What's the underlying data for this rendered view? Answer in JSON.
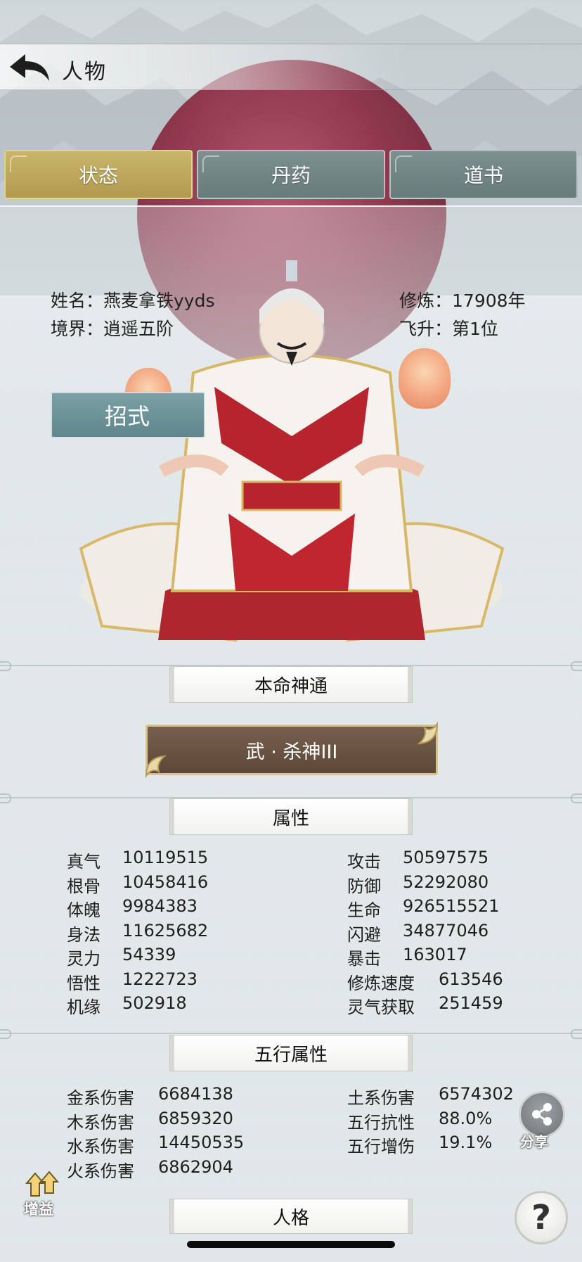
{
  "header": {
    "title": "人物"
  },
  "tabs": [
    {
      "label": "状态",
      "active": true
    },
    {
      "label": "丹药",
      "active": false
    },
    {
      "label": "道书",
      "active": false
    }
  ],
  "profile": {
    "name_label": "姓名：",
    "name": "燕麦拿铁yyds",
    "realm_label": "境界：",
    "realm": "逍遥五阶",
    "cultivation_label": "修炼：",
    "cultivation": "17908年",
    "ascension_label": "飞升：",
    "ascension": "第1位"
  },
  "skill_button": "招式",
  "natal_section": {
    "title": "本命神通",
    "ability": "武 · 杀神III"
  },
  "attributes": {
    "title": "属性",
    "left": [
      {
        "k": "真气",
        "v": "10119515"
      },
      {
        "k": "根骨",
        "v": "10458416"
      },
      {
        "k": "体魄",
        "v": "9984383"
      },
      {
        "k": "身法",
        "v": "11625682"
      },
      {
        "k": "灵力",
        "v": "54339"
      },
      {
        "k": "悟性",
        "v": "1222723"
      },
      {
        "k": "机缘",
        "v": "502918"
      }
    ],
    "right": [
      {
        "k": "攻击",
        "v": "50597575"
      },
      {
        "k": "防御",
        "v": "52292080"
      },
      {
        "k": "生命",
        "v": "926515521"
      },
      {
        "k": "闪避",
        "v": "34877046"
      },
      {
        "k": "暴击",
        "v": "163017"
      },
      {
        "k": "修炼速度",
        "v": "613546"
      },
      {
        "k": "灵气获取",
        "v": "251459"
      }
    ]
  },
  "elements": {
    "title": "五行属性",
    "left": [
      {
        "k": "金系伤害",
        "v": "6684138"
      },
      {
        "k": "木系伤害",
        "v": "6859320"
      },
      {
        "k": "水系伤害",
        "v": "14450535"
      },
      {
        "k": "火系伤害",
        "v": "6862904"
      }
    ],
    "right": [
      {
        "k": "土系伤害",
        "v": "6574302"
      },
      {
        "k": "五行抗性",
        "v": "88.0%"
      },
      {
        "k": "五行增伤",
        "v": "19.1%"
      }
    ]
  },
  "personality": {
    "title": "人格"
  },
  "floating": {
    "share_label": "分享",
    "buff_label": "增益",
    "help_symbol": "?"
  },
  "icons": {
    "back": "back-arrow-icon",
    "share": "share-icon",
    "buff": "buff-up-arrow-icon",
    "help": "question-icon"
  },
  "colors": {
    "tab_active": "#c0ab5f",
    "tab_inactive": "#748787",
    "skill_button": "#6d9398",
    "ability_bg": "#6a5342",
    "ability_border": "#d9c28a"
  }
}
